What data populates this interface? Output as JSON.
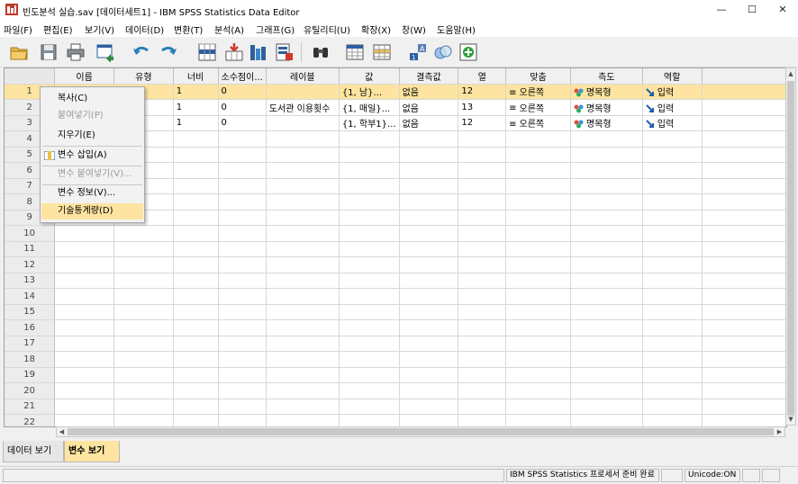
{
  "window": {
    "title": "빈도분석 실습.sav [데이터세트1] - IBM SPSS Statistics Data Editor",
    "minimize": "—",
    "maximize": "☐",
    "close": "✕"
  },
  "menu": [
    "파일(F)",
    "편집(E)",
    "보기(V)",
    "데이터(D)",
    "변환(T)",
    "분석(A)",
    "그래프(G)",
    "유틸리티(U)",
    "확장(X)",
    "창(W)",
    "도움말(H)"
  ],
  "toolbar": {
    "icons": [
      "open-folder-icon",
      "save-icon",
      "print-icon",
      "recall-dialog-icon",
      "undo-icon",
      "redo-icon",
      "goto-case-icon",
      "goto-variable-icon",
      "variables-icon",
      "run-descriptives-icon",
      "find-icon",
      "split-file-icon",
      "select-cases-icon",
      "value-labels-icon",
      "use-sets-icon",
      "show-all-variables-icon"
    ]
  },
  "grid": {
    "columns": [
      "이름",
      "유형",
      "너비",
      "소수점이...",
      "레이블",
      "값",
      "결측값",
      "열",
      "맞춤",
      "측도",
      "역할"
    ],
    "rows": [
      {
        "num": "1",
        "cells": [
          "",
          "",
          "1",
          "0",
          "",
          "{1, 남}...",
          "없음",
          "12",
          "오른쪽",
          "명목형",
          "입력"
        ]
      },
      {
        "num": "2",
        "cells": [
          "",
          "",
          "1",
          "0",
          "도서관 이용횟수",
          "{1, 매일}...",
          "없음",
          "13",
          "오른쪽",
          "명목형",
          "입력"
        ]
      },
      {
        "num": "3",
        "cells": [
          "",
          "",
          "1",
          "0",
          "",
          "{1, 학부1}...",
          "없음",
          "12",
          "오른쪽",
          "명목형",
          "입력"
        ]
      }
    ],
    "empty_row_numbers": [
      "4",
      "5",
      "6",
      "7",
      "8",
      "9",
      "10",
      "11",
      "12",
      "13",
      "14",
      "15",
      "16",
      "17",
      "18",
      "19",
      "20",
      "21",
      "22"
    ]
  },
  "context_menu": {
    "items": [
      {
        "label": "복사(C)",
        "enabled": true
      },
      {
        "label": "붙여넣기(P)",
        "enabled": false
      },
      {
        "label": "지우기(E)",
        "enabled": true
      },
      {
        "label": "변수 삽입(A)",
        "enabled": true
      },
      {
        "label": "변수 붙여넣기(V)...",
        "enabled": false
      },
      {
        "label": "변수 정보(V)...",
        "enabled": true
      },
      {
        "label": "기술통계량(D)",
        "enabled": true,
        "highlighted": true
      }
    ]
  },
  "tabs": [
    "데이터 보기(D)",
    "변수 보기(V)"
  ],
  "active_tab": "변수 보기(V)",
  "status": {
    "processor": "IBM SPSS Statistics 프로세서 준비 완료",
    "encoding": "Unicode:ON"
  },
  "colors": {
    "selection": "#fde4a0",
    "header": "#f0f0f0",
    "grid_line": "#d8d8d8"
  }
}
